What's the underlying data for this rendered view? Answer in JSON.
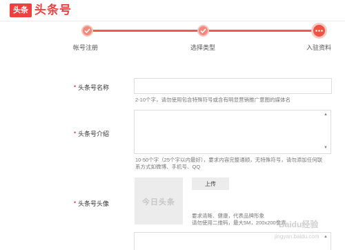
{
  "header": {
    "logo_badge": "头条",
    "logo_text": "头条号"
  },
  "stepper": {
    "steps": [
      {
        "label": "帐号注册",
        "state": "done"
      },
      {
        "label": "选择类型",
        "state": "done"
      },
      {
        "label": "入驻资料",
        "state": "current"
      }
    ],
    "accent_color": "#ed4040"
  },
  "form": {
    "required_mark": "•",
    "name": {
      "label": "头条号名称",
      "value": "",
      "hint": "2-10个字，请勿使用包含特殊符号或含有明显营销推广意图的媒体名"
    },
    "intro": {
      "label": "头条号介绍",
      "value": "",
      "hint_line1": "10-50个字（25个字以内最好），要求内容完整通顺，无特殊符号，请勿添加任何联",
      "hint_line2": "系方式如微博、手机号、QQ"
    },
    "avatar": {
      "label": "头条号头像",
      "placeholder_text": "今日头条",
      "upload_button": "上传",
      "hint_line1": "要求清晰、健康，代表品牌形象",
      "hint_line2": "请勿使用二维码，最大5M，200x200像素"
    }
  },
  "watermark": {
    "text": "Baidu经验",
    "sub": "jingyan.baidu.com"
  }
}
